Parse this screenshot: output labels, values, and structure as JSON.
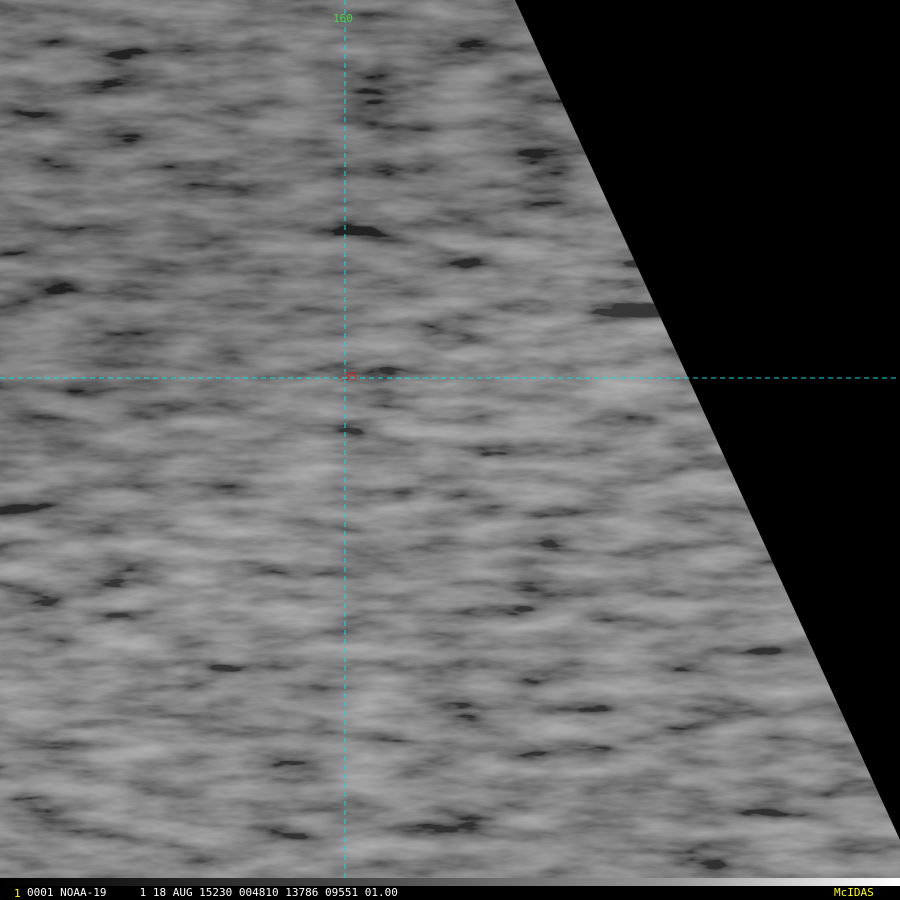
{
  "colors": {
    "background": "#000000",
    "graticule": "#00e0e0",
    "lon_label": "#3fd23f",
    "lat_label": "#d22a2a",
    "frame_number": "#ffff00",
    "status_text": "#ffffff",
    "brand": "#ffff00"
  },
  "graticule": {
    "longitude_label": "160",
    "latitude_label": "-35"
  },
  "status_bar": {
    "frame_number": "1",
    "info": "0001 NOAA-19     1 18 AUG 15230 004810 13786 09551 01.00",
    "brand": "McIDAS"
  }
}
